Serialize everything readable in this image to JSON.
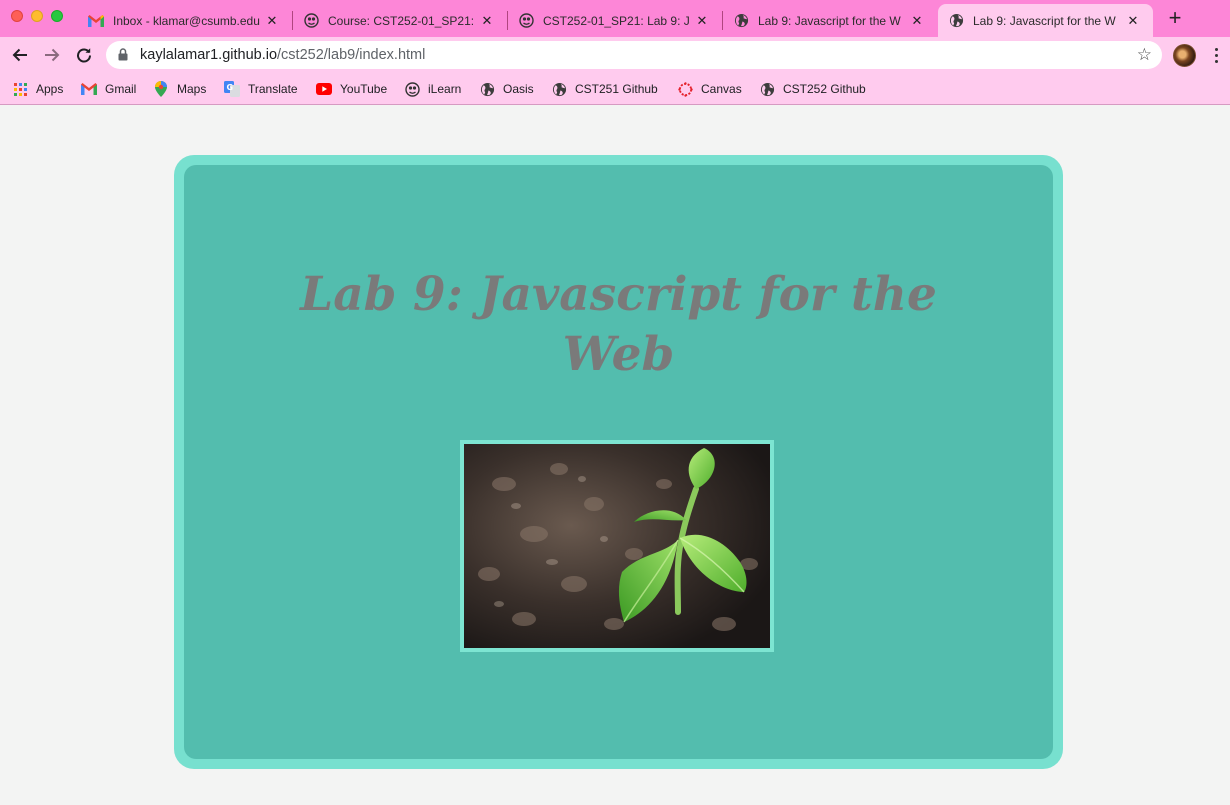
{
  "browser": {
    "tabs": [
      {
        "title": "Inbox - klamar@csumb.edu",
        "icon": "gmail-icon",
        "active": false
      },
      {
        "title": "Course: CST252-01_SP21:",
        "icon": "ilearn-icon",
        "active": false
      },
      {
        "title": "CST252-01_SP21: Lab 9: J",
        "icon": "ilearn-icon",
        "active": false
      },
      {
        "title": "Lab 9: Javascript for the W",
        "icon": "globe-icon",
        "active": false
      },
      {
        "title": "Lab 9: Javascript for the W",
        "icon": "globe-icon",
        "active": true
      }
    ],
    "new_tab_label": "+",
    "address": {
      "host": "kaylalamar1.github.io",
      "path": "/cst252/lab9/index.html"
    },
    "bookmarks": [
      {
        "label": "Apps",
        "icon": "apps-grid-icon"
      },
      {
        "label": "Gmail",
        "icon": "gmail-icon"
      },
      {
        "label": "Maps",
        "icon": "maps-pin-icon"
      },
      {
        "label": "Translate",
        "icon": "translate-icon"
      },
      {
        "label": "YouTube",
        "icon": "youtube-icon"
      },
      {
        "label": "iLearn",
        "icon": "ilearn-icon"
      },
      {
        "label": "Oasis",
        "icon": "globe-icon"
      },
      {
        "label": "CST251 Github",
        "icon": "globe-icon"
      },
      {
        "label": "Canvas",
        "icon": "canvas-icon"
      },
      {
        "label": "CST252 Github",
        "icon": "globe-icon"
      }
    ],
    "colors": {
      "tabstrip": "#fd86d7",
      "toolbar": "#ffcbee"
    }
  },
  "page": {
    "title": "Lab 9: Javascript for the Web",
    "image_alt": "seedling sprouting from soil",
    "colors": {
      "background": "#f3f4f3",
      "card_border": "#77e0cf",
      "card_fill": "#53bdae",
      "title_text": "#7a7a7a"
    }
  }
}
